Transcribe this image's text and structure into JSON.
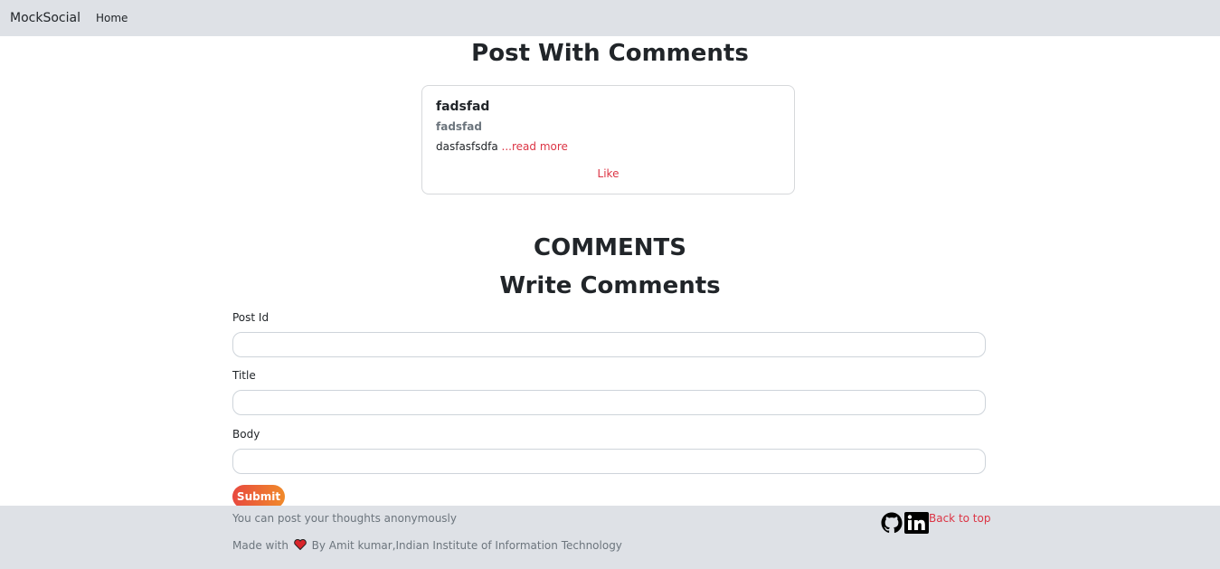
{
  "navbar": {
    "brand": "MockSocial",
    "home_label": "Home"
  },
  "page_title": "Post With Comments",
  "post": {
    "title": "fadsfad",
    "subtitle": "fadsfad",
    "body": "dasfasfsdfa ",
    "read_more": "...read more",
    "like_label": "Like"
  },
  "comments_heading": "COMMENTS",
  "write_heading": "Write Comments",
  "form": {
    "post_id_label": "Post Id",
    "post_id_value": "",
    "title_label": "Title",
    "title_value": "",
    "body_label": "Body",
    "body_value": "",
    "submit_label": "Submit"
  },
  "footer": {
    "tagline": "You can post your thoughts anonymously",
    "made_with": "Made with",
    "credit": "By Amit kumar,Indian Institute of Information Technology",
    "back_to_top": "Back to top",
    "icons": [
      "github-icon",
      "linkedin-icon",
      "heart-icon"
    ]
  },
  "colors": {
    "navbar_bg": "#dee1e6",
    "footer_bg": "#dee1e6",
    "link_red": "#dc3545",
    "submit_gradient_start": "#e8493f",
    "submit_gradient_end": "#f08a2a"
  }
}
